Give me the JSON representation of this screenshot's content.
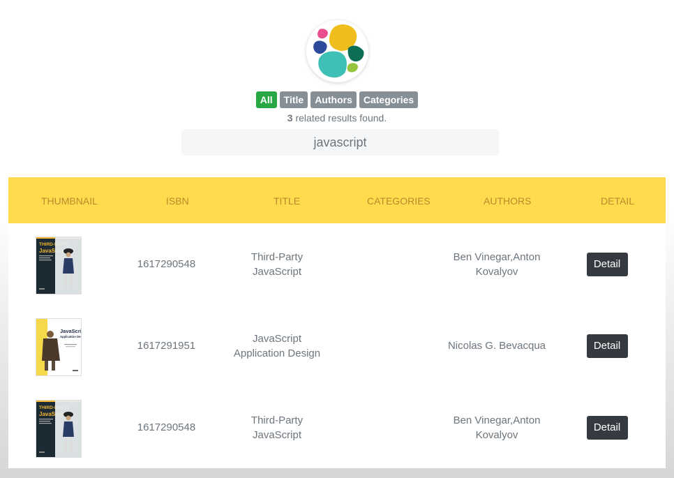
{
  "filters": {
    "all": "All",
    "title": "Title",
    "authors": "Authors",
    "categories": "Categories"
  },
  "results": {
    "count": "3",
    "text": " related results found."
  },
  "search": {
    "value": "javascript"
  },
  "table": {
    "headers": {
      "thumbnail": "THUMBNAIL",
      "isbn": "ISBN",
      "title": "TITLE",
      "categories": "CATEGORIES",
      "authors": "AUTHORS",
      "detail": "DETAIL"
    },
    "rows": [
      {
        "isbn": "1617290548",
        "title": "Third-Party JavaScript",
        "categories": "",
        "authors": "Ben Vinegar,Anton Kovalyov",
        "detail": "Detail",
        "cover_title": "THIRD-PARTY JavaScript",
        "cover_color": "#1c2b33"
      },
      {
        "isbn": "1617291951",
        "title": "JavaScript Application Design",
        "categories": "",
        "authors": "Nicolas G. Bevacqua",
        "detail": "Detail",
        "cover_title": "JavaScript Application Design",
        "cover_color": "#f5d94a"
      },
      {
        "isbn": "1617290548",
        "title": "Third-Party JavaScript",
        "categories": "",
        "authors": "Ben Vinegar,Anton Kovalyov",
        "detail": "Detail",
        "cover_title": "THIRD-PARTY JavaScript",
        "cover_color": "#1c2b33"
      }
    ]
  },
  "colors": {
    "active_filter": "#28a745",
    "inactive_filter": "#868e96",
    "header_bg": "#ffdb4d",
    "header_text": "#b98a2c",
    "detail_button": "#343a40"
  }
}
